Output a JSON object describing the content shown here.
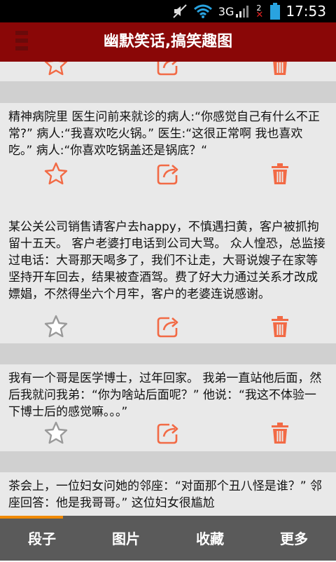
{
  "status_bar": {
    "time": "17:53",
    "network": "3G",
    "sim_badge": "2"
  },
  "header": {
    "title": "幽默笑话,搞笑趣图"
  },
  "feed": {
    "items": [
      {
        "text": ""
      },
      {
        "text": "精神病院里 医生问前来就诊的病人:“你感觉自己有什么不正常?” 病人:“我喜欢吃火锅。” 医生:“这很正常啊 我也喜欢吃。” 病人:“你喜欢吃锅盖还是锅底？“"
      },
      {
        "text": "某公关公司销售请客户去happy，不慎遇扫黄，客户被抓拘留十五天。 客户老婆打电话到公司大骂。 众人惶恐，总监接过电话：大哥那天喝多了，我们不让走，大哥说嫂子在家等坚持开车回去，结果被查酒驾。费了好大力通过关系才改成嫖娼，不然得坐六个月牢，客户的老婆连说感谢。"
      },
      {
        "text": "我有一个哥是医学博士，过年回家。 我弟一直站他后面，然后我就问我弟：“你为啥站后面呢？” 他说：“我这不体验一下博士后的感觉嘛。。。”"
      },
      {
        "text": "茶会上，一位妇女问她的邻座：“对面那个丑八怪是谁？” 邻座回答：他是我哥哥。” 这位妇女很尴尬"
      }
    ]
  },
  "bottom_nav": {
    "tabs": [
      {
        "label": "段子"
      },
      {
        "label": "图片"
      },
      {
        "label": "收藏"
      },
      {
        "label": "更多"
      }
    ]
  },
  "colors": {
    "header_bg": "#8a0707",
    "nav_bg": "#5a5a5a",
    "accent": "#f26a45",
    "indicator": "#f08a00"
  }
}
